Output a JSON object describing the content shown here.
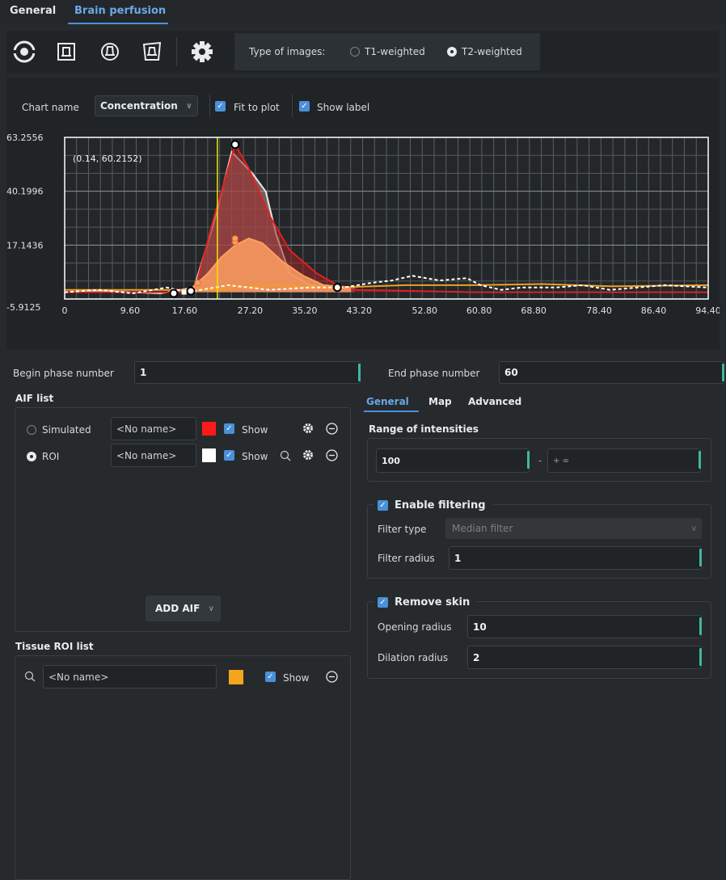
{
  "tabs": [
    {
      "label": "General"
    },
    {
      "label": "Brain perfusion",
      "active": true
    }
  ],
  "toolbar": {
    "icons": [
      "target-icon",
      "arterial-icon",
      "perfusion-icon",
      "map-icon",
      "gear-icon"
    ],
    "type_of_images_label": "Type of images:",
    "options": [
      {
        "label": "T1-weighted",
        "selected": false
      },
      {
        "label": "T2-weighted",
        "selected": true
      }
    ]
  },
  "chart_controls": {
    "chart_name_label": "Chart name",
    "chart_name_value": "Concentration",
    "fit_to_plot_label": "Fit to plot",
    "fit_to_plot_checked": true,
    "show_label_label": "Show label",
    "show_label_checked": true
  },
  "chart_data": {
    "type": "line",
    "annotation": "(0.14, 60.2152)",
    "y_ticks": [
      "63.2556",
      "40.1996",
      "17.1436",
      "-5.9125"
    ],
    "x_ticks": [
      "0",
      "9.60",
      "17.60",
      "27.20",
      "35.20",
      "43.20",
      "52.80",
      "60.80",
      "68.80",
      "78.40",
      "86.40",
      "94.40"
    ],
    "ylim": [
      -5.9125,
      63.2556
    ],
    "xlim": [
      0,
      94.4
    ],
    "cursor_x": 22.4,
    "grid": true,
    "series": [
      {
        "color": "#e8e8e8",
        "style": "solid-fill",
        "points": [
          [
            0,
            -3
          ],
          [
            5,
            -2.5
          ],
          [
            10,
            -3
          ],
          [
            14,
            -3.5
          ],
          [
            19,
            -1
          ],
          [
            22,
            28
          ],
          [
            24.5,
            57
          ],
          [
            27.5,
            48
          ],
          [
            29.5,
            40
          ],
          [
            31,
            22
          ],
          [
            33,
            5
          ],
          [
            36,
            0
          ],
          [
            40,
            -1
          ],
          [
            42.5,
            -1
          ]
        ]
      },
      {
        "color": "#e02020",
        "style": "solid-fill",
        "points": [
          [
            0,
            -3
          ],
          [
            19,
            -3
          ],
          [
            22,
            30
          ],
          [
            25,
            60.2
          ],
          [
            27,
            50
          ],
          [
            30,
            30
          ],
          [
            33,
            15
          ],
          [
            37,
            5
          ],
          [
            40,
            0
          ],
          [
            43,
            -2
          ],
          [
            60,
            -3
          ],
          [
            94.4,
            -3
          ]
        ]
      },
      {
        "color": "#ff9f60",
        "style": "fill",
        "points": [
          [
            18,
            -3
          ],
          [
            21,
            5
          ],
          [
            23,
            12
          ],
          [
            25,
            17
          ],
          [
            27,
            20
          ],
          [
            29,
            18
          ],
          [
            32,
            10
          ],
          [
            35,
            4
          ],
          [
            38,
            0
          ],
          [
            42,
            -1
          ]
        ]
      },
      {
        "color": "#f0a020",
        "style": "solid",
        "points": [
          [
            0,
            -2
          ],
          [
            10,
            -2
          ],
          [
            20,
            -2
          ],
          [
            30,
            0
          ],
          [
            40,
            -1
          ],
          [
            50,
            0
          ],
          [
            60,
            0
          ],
          [
            70,
            0.5
          ],
          [
            80,
            -0.5
          ],
          [
            94.4,
            0
          ]
        ]
      },
      {
        "color": "#ffffff",
        "style": "dashed",
        "points": [
          [
            0,
            -3
          ],
          [
            5,
            -2
          ],
          [
            10,
            -3.5
          ],
          [
            15,
            -1
          ],
          [
            18,
            -3
          ],
          [
            24,
            0
          ],
          [
            30,
            -2
          ],
          [
            36,
            -1
          ],
          [
            41,
            -1
          ],
          [
            45,
            1
          ],
          [
            48,
            2
          ],
          [
            51,
            4
          ],
          [
            55,
            2
          ],
          [
            59,
            3
          ],
          [
            61,
            0
          ],
          [
            64,
            -2
          ],
          [
            67,
            -1
          ],
          [
            72,
            -1
          ],
          [
            76,
            0
          ],
          [
            80,
            -2
          ],
          [
            84,
            -1
          ],
          [
            88,
            0
          ],
          [
            94.4,
            -1
          ]
        ]
      }
    ]
  },
  "phase": {
    "begin_label": "Begin phase number",
    "begin_value": "1",
    "end_label": "End phase number",
    "end_value": "60"
  },
  "aif": {
    "title": "AIF list",
    "rows": [
      {
        "type": "Simulated",
        "selected": false,
        "name_placeholder": "<No name>",
        "color": "#ff1a1a",
        "show_label": "Show",
        "has_search": false
      },
      {
        "type": "ROI",
        "selected": true,
        "name_placeholder": "<No name>",
        "color": "#ffffff",
        "show_label": "Show",
        "has_search": true
      }
    ],
    "add_button": "ADD AIF"
  },
  "tissue": {
    "title": "Tissue ROI list",
    "name_placeholder": "<No name>",
    "color": "#f7a41d",
    "show_label": "Show"
  },
  "settings_tabs": [
    {
      "label": "General",
      "active": true
    },
    {
      "label": "Map"
    },
    {
      "label": "Advanced"
    }
  ],
  "range": {
    "title": "Range of intensities",
    "min": "100",
    "separator": "-",
    "max": "+ ∞"
  },
  "filtering": {
    "label": "Enable filtering",
    "checked": true,
    "filter_type_label": "Filter type",
    "filter_type_value": "Median filter",
    "filter_radius_label": "Filter radius",
    "filter_radius_value": "1"
  },
  "skin": {
    "label": "Remove skin",
    "checked": true,
    "opening_label": "Opening radius",
    "opening_value": "10",
    "dilation_label": "Dilation radius",
    "dilation_value": "2"
  }
}
